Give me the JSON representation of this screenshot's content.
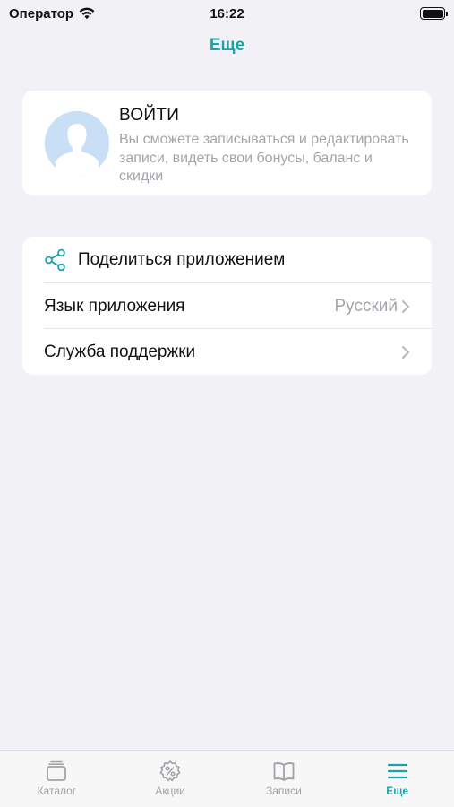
{
  "status_bar": {
    "carrier": "Оператор",
    "time": "16:22"
  },
  "nav": {
    "title": "Еще"
  },
  "login": {
    "title": "ВОЙТИ",
    "description": "Вы сможете записываться и редактировать записи, видеть свои бонусы, баланс и скидки"
  },
  "menu": {
    "share_label": "Поделиться приложением",
    "language_label": "Язык приложения",
    "language_value": "Русский",
    "support_label": "Служба поддержки"
  },
  "tabs": [
    {
      "label": "Каталог",
      "icon": "catalog-icon"
    },
    {
      "label": "Акции",
      "icon": "discount-icon"
    },
    {
      "label": "Записи",
      "icon": "book-icon"
    },
    {
      "label": "Еще",
      "icon": "menu-icon"
    }
  ],
  "colors": {
    "accent": "#1aa3a8",
    "background": "#f1f1f6",
    "muted": "#a4a4aa"
  }
}
